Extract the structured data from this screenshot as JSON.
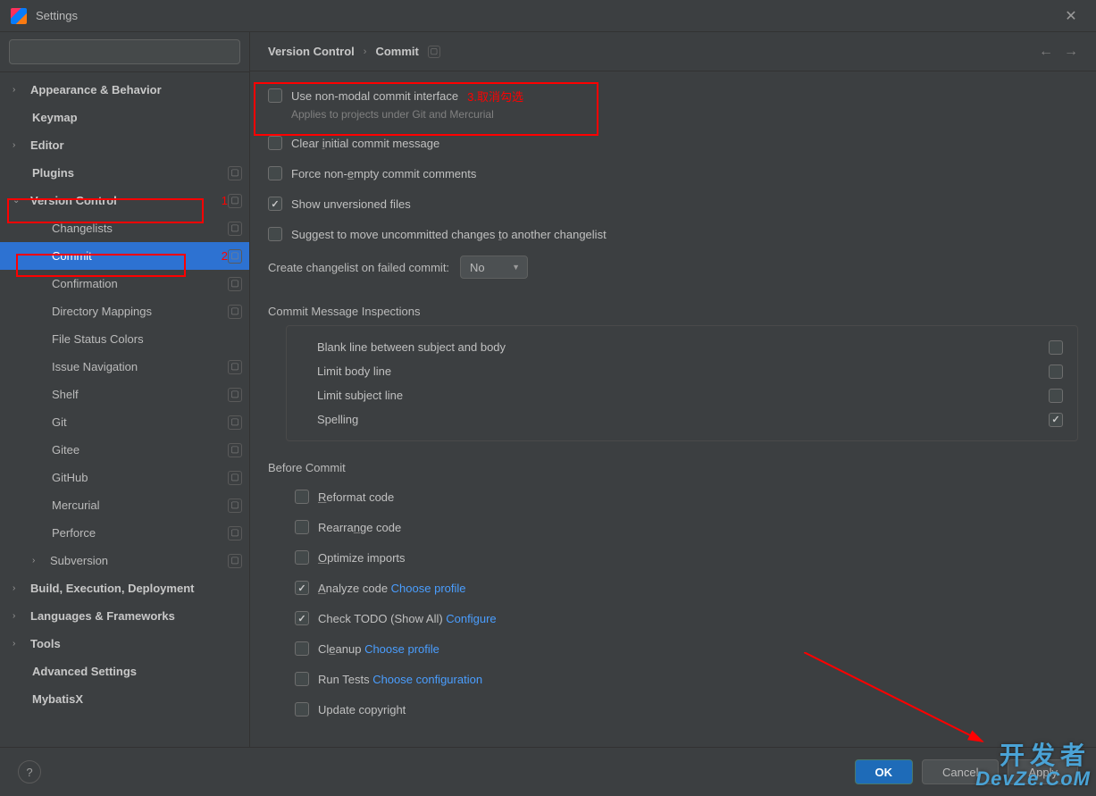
{
  "title": "Settings",
  "search": {
    "placeholder": ""
  },
  "annotations": {
    "num1": "1",
    "num2": "2",
    "text3": "3.取消勾选"
  },
  "sidebar": {
    "items": [
      {
        "label": "Appearance & Behavior",
        "type": "expandable",
        "bold": true,
        "level": 0,
        "chev": "›"
      },
      {
        "label": "Keymap",
        "type": "leaf",
        "bold": true,
        "level": 1
      },
      {
        "label": "Editor",
        "type": "expandable",
        "bold": true,
        "level": 0,
        "chev": "›"
      },
      {
        "label": "Plugins",
        "type": "leaf",
        "bold": true,
        "level": 1,
        "badge": true
      },
      {
        "label": "Version Control",
        "type": "expandable",
        "bold": true,
        "level": 0,
        "chev": "⌄",
        "badge": true,
        "anno1": true
      },
      {
        "label": "Changelists",
        "type": "leaf",
        "level": 2,
        "badge": true
      },
      {
        "label": "Commit",
        "type": "leaf",
        "level": 2,
        "badge": true,
        "selected": true,
        "anno2": true
      },
      {
        "label": "Confirmation",
        "type": "leaf",
        "level": 2,
        "badge": true
      },
      {
        "label": "Directory Mappings",
        "type": "leaf",
        "level": 2,
        "badge": true
      },
      {
        "label": "File Status Colors",
        "type": "leaf",
        "level": 2
      },
      {
        "label": "Issue Navigation",
        "type": "leaf",
        "level": 2,
        "badge": true
      },
      {
        "label": "Shelf",
        "type": "leaf",
        "level": 2,
        "badge": true
      },
      {
        "label": "Git",
        "type": "leaf",
        "level": 2,
        "badge": true
      },
      {
        "label": "Gitee",
        "type": "leaf",
        "level": 2,
        "badge": true
      },
      {
        "label": "GitHub",
        "type": "leaf",
        "level": 2,
        "badge": true
      },
      {
        "label": "Mercurial",
        "type": "leaf",
        "level": 2,
        "badge": true
      },
      {
        "label": "Perforce",
        "type": "leaf",
        "level": 2,
        "badge": true
      },
      {
        "label": "Subversion",
        "type": "expandable",
        "level": 1,
        "chev": "›",
        "badge": true
      },
      {
        "label": "Build, Execution, Deployment",
        "type": "expandable",
        "bold": true,
        "level": 0,
        "chev": "›"
      },
      {
        "label": "Languages & Frameworks",
        "type": "expandable",
        "bold": true,
        "level": 0,
        "chev": "›"
      },
      {
        "label": "Tools",
        "type": "expandable",
        "bold": true,
        "level": 0,
        "chev": "›"
      },
      {
        "label": "Advanced Settings",
        "type": "leaf",
        "bold": true,
        "level": 1
      },
      {
        "label": "MybatisX",
        "type": "leaf",
        "bold": true,
        "level": 1
      }
    ]
  },
  "breadcrumb": {
    "seg1": "Version Control",
    "seg2": "Commit"
  },
  "main": {
    "nonmodal": {
      "label": "Use non-modal commit interface",
      "desc": "Applies to projects under Git and Mercurial",
      "checked": false
    },
    "clear_initial": {
      "label_pre": "Clear ",
      "label_u": "i",
      "label_post": "nitial commit message",
      "checked": false
    },
    "force_nonempty": {
      "label_pre": "Force non-",
      "label_u": "e",
      "label_post": "mpty commit comments",
      "checked": false
    },
    "show_unversioned": {
      "label": "Show unversioned files",
      "checked": true
    },
    "suggest_move": {
      "label_pre": "Suggest to move uncommitted changes ",
      "label_u": "t",
      "label_post": "o another changelist",
      "checked": false
    },
    "create_changelist": {
      "label": "Create changelist on failed commit:",
      "value": "No"
    },
    "inspections_title": "Commit Message Inspections",
    "inspections": {
      "blank": {
        "label": "Blank line between subject and body",
        "checked": false
      },
      "limit_body": {
        "label": "Limit body line",
        "checked": false
      },
      "limit_subject": {
        "label": "Limit subject line",
        "checked": false
      },
      "spelling": {
        "label": "Spelling",
        "checked": true
      }
    },
    "before_title": "Before Commit",
    "before": {
      "reformat": {
        "label_u": "R",
        "label_post": "eformat code",
        "checked": false
      },
      "rearrange": {
        "label_pre": "Rearra",
        "label_u": "n",
        "label_post": "ge code",
        "checked": false
      },
      "optimize": {
        "label_u": "O",
        "label_post": "ptimize imports",
        "checked": false
      },
      "analyze": {
        "label_u": "A",
        "label_post": "nalyze code ",
        "link": "Choose profile",
        "checked": true
      },
      "todo": {
        "label": "Check TODO (Show All) ",
        "link": "Configure",
        "checked": true
      },
      "cleanup": {
        "label_pre": "Cl",
        "label_u": "e",
        "label_post": "anup ",
        "link": "Choose profile",
        "checked": false
      },
      "runtests": {
        "label": "Run Tests ",
        "link": "Choose configuration",
        "checked": false
      },
      "copyright": {
        "label": "Update copyright",
        "checked": false
      }
    }
  },
  "footer": {
    "ok": "OK",
    "cancel": "Cancel",
    "apply": "Apply"
  },
  "watermark": {
    "line1": "开发者",
    "line2": "DevZe.CoM"
  }
}
